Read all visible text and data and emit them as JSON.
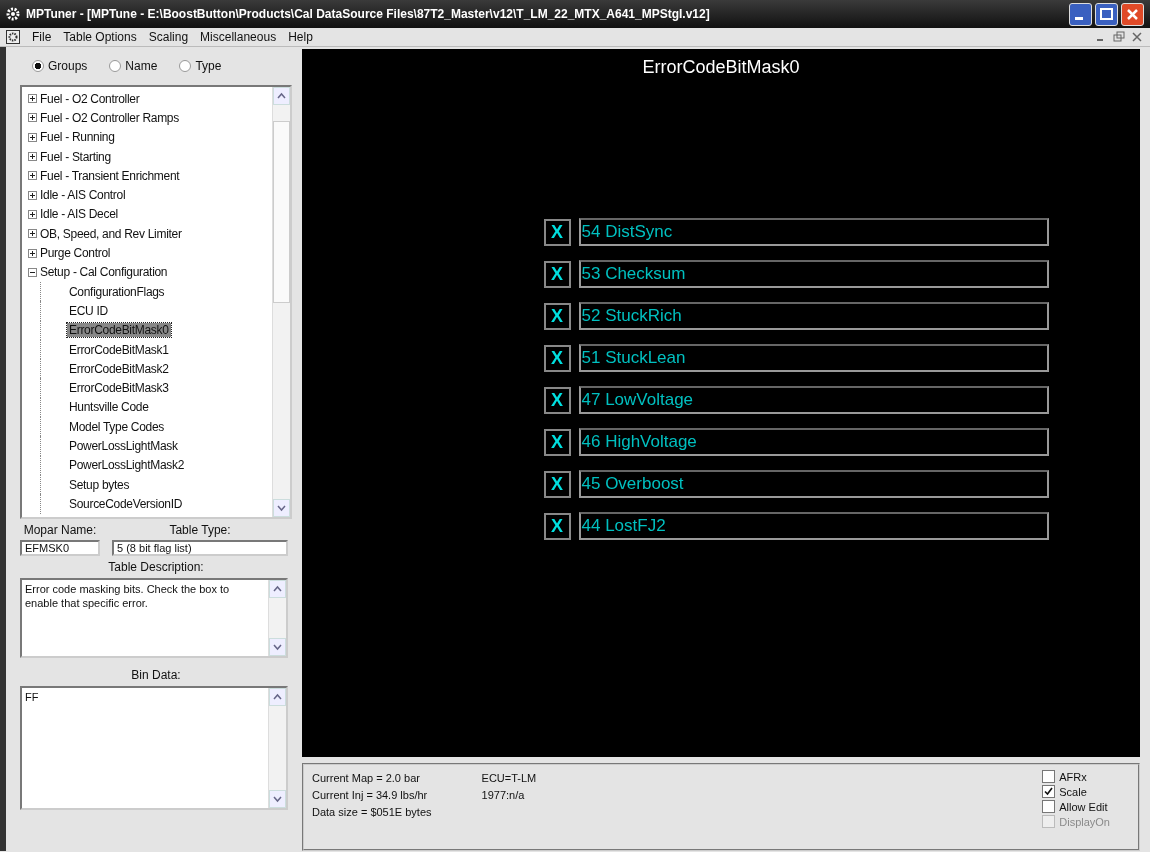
{
  "window": {
    "title": "MPTuner - [MPTune - E:\\BoostButton\\Products\\Cal DataSource Files\\87T2_Master\\v12\\T_LM_22_MTX_A641_MPStgI.v12]"
  },
  "menu": [
    "File",
    "Table Options",
    "Scaling",
    "Miscellaneous",
    "Help"
  ],
  "view_options": [
    {
      "label": "Groups",
      "selected": true
    },
    {
      "label": "Name",
      "selected": false
    },
    {
      "label": "Type",
      "selected": false
    }
  ],
  "tree": [
    {
      "label": "Fuel - O2 Controller",
      "expanded": false
    },
    {
      "label": "Fuel - O2 Controller Ramps",
      "expanded": false
    },
    {
      "label": "Fuel - Running",
      "expanded": false
    },
    {
      "label": "Fuel - Starting",
      "expanded": false
    },
    {
      "label": "Fuel - Transient Enrichment",
      "expanded": false
    },
    {
      "label": "Idle - AIS Control",
      "expanded": false
    },
    {
      "label": "Idle - AIS Decel",
      "expanded": false
    },
    {
      "label": "OB, Speed, and Rev Limiter",
      "expanded": false
    },
    {
      "label": "Purge Control",
      "expanded": false
    },
    {
      "label": "Setup - Cal Configuration",
      "expanded": true,
      "children": [
        {
          "label": "ConfigurationFlags",
          "selected": false
        },
        {
          "label": "ECU ID",
          "selected": false
        },
        {
          "label": "ErrorCodeBitMask0",
          "selected": true
        },
        {
          "label": "ErrorCodeBitMask1",
          "selected": false
        },
        {
          "label": "ErrorCodeBitMask2",
          "selected": false
        },
        {
          "label": "ErrorCodeBitMask3",
          "selected": false
        },
        {
          "label": "Huntsville Code",
          "selected": false
        },
        {
          "label": "Model Type Codes",
          "selected": false
        },
        {
          "label": "PowerLossLightMask",
          "selected": false
        },
        {
          "label": "PowerLossLightMask2",
          "selected": false
        },
        {
          "label": "Setup bytes",
          "selected": false
        },
        {
          "label": "SourceCodeVersionID",
          "selected": false
        }
      ]
    }
  ],
  "mopar_name": {
    "label": "Mopar Name:",
    "value": "EFMSK0"
  },
  "table_type": {
    "label": "Table Type:",
    "value": "5 (8 bit flag list)"
  },
  "table_description": {
    "label": "Table Description:",
    "value": "Error code masking bits. Check the box to enable that specific error."
  },
  "bin_data": {
    "label": "Bin Data:",
    "value": "FF"
  },
  "table": {
    "title": "ErrorCodeBitMask0",
    "flags": [
      {
        "mark": "X",
        "checked": true,
        "label": "54 DistSync"
      },
      {
        "mark": "X",
        "checked": true,
        "label": "53 Checksum"
      },
      {
        "mark": "X",
        "checked": true,
        "label": "52 StuckRich"
      },
      {
        "mark": "X",
        "checked": true,
        "label": "51 StuckLean"
      },
      {
        "mark": "X",
        "checked": true,
        "label": "47 LowVoltage"
      },
      {
        "mark": "X",
        "checked": true,
        "label": "46 HighVoltage"
      },
      {
        "mark": "X",
        "checked": true,
        "label": "45 Overboost"
      },
      {
        "mark": "X",
        "checked": true,
        "label": "44 LostFJ2"
      }
    ]
  },
  "status": {
    "info": [
      "Current Map = 2.0 bar",
      "Current Inj = 34.9 lbs/hr",
      "Data size = $051E bytes"
    ],
    "ecu": [
      "ECU=T-LM",
      "1977:n/a"
    ],
    "options": [
      {
        "label": "AFRx",
        "checked": false,
        "disabled": false
      },
      {
        "label": "Scale",
        "checked": true,
        "disabled": false
      },
      {
        "label": "Allow Edit",
        "checked": false,
        "disabled": false
      },
      {
        "label": "DisplayOn",
        "checked": false,
        "disabled": true
      }
    ]
  }
}
